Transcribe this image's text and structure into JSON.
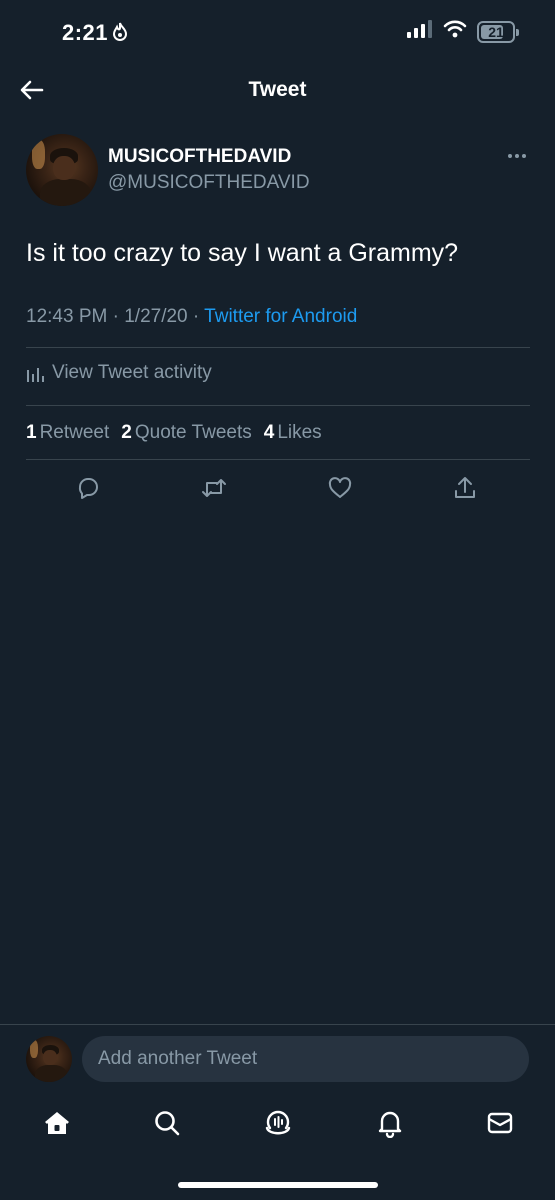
{
  "status_bar": {
    "time": "2:21",
    "battery": "21"
  },
  "header": {
    "title": "Tweet"
  },
  "tweet": {
    "display_name": "MUSICOFTHEDAVID",
    "handle": "@MUSICOFTHEDAVID",
    "text": "Is it too crazy to say I want a Grammy?",
    "time": "12:43 PM",
    "date": "1/27/20",
    "separator": "·",
    "source": "Twitter for Android"
  },
  "activity": {
    "label": "View Tweet activity"
  },
  "stats": {
    "retweets_count": "1",
    "retweets_label": "Retweet",
    "quotes_count": "2",
    "quotes_label": "Quote Tweets",
    "likes_count": "4",
    "likes_label": "Likes"
  },
  "reply": {
    "placeholder": "Add another Tweet"
  },
  "icons": {
    "back": "arrow-left-icon",
    "more": "more-horizontal-icon",
    "activity": "bar-chart-icon",
    "reply": "comment-icon",
    "retweet": "retweet-icon",
    "like": "heart-icon",
    "share": "share-icon",
    "home": "home-icon",
    "search": "search-icon",
    "spaces": "spaces-icon",
    "notifications": "bell-icon",
    "messages": "mail-icon"
  },
  "colors": {
    "background": "#15202b",
    "accent": "#1d9bf0",
    "secondary_text": "#8899a6",
    "divider": "#38444d"
  }
}
